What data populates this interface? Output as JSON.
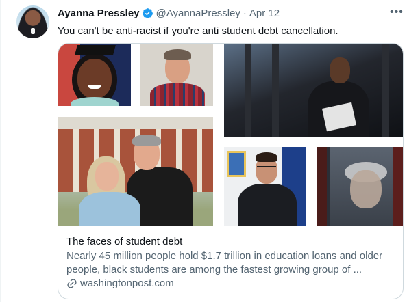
{
  "tweet": {
    "author_name": "Ayanna Pressley",
    "handle": "@AyannaPressley",
    "separator": "·",
    "date": "Apr 12",
    "more_label": "•••",
    "text": "You can't be anti-racist if you're anti student debt cancellation."
  },
  "card": {
    "title": "The faces of student debt",
    "description_line1": "Nearly 45 million people hold $1.7 trillion in education loans and older",
    "description_line2": "people, black students are among the fastest growing group of ...",
    "domain": "washingtonpost.com"
  },
  "icons": {
    "verified": "verified-badge-icon",
    "more": "more-horizontal-icon",
    "link": "link-icon"
  },
  "colors": {
    "verified_blue": "#1d9bf0",
    "secondary_text": "#536471",
    "primary_text": "#0f1419",
    "card_border": "#cfd9de"
  }
}
